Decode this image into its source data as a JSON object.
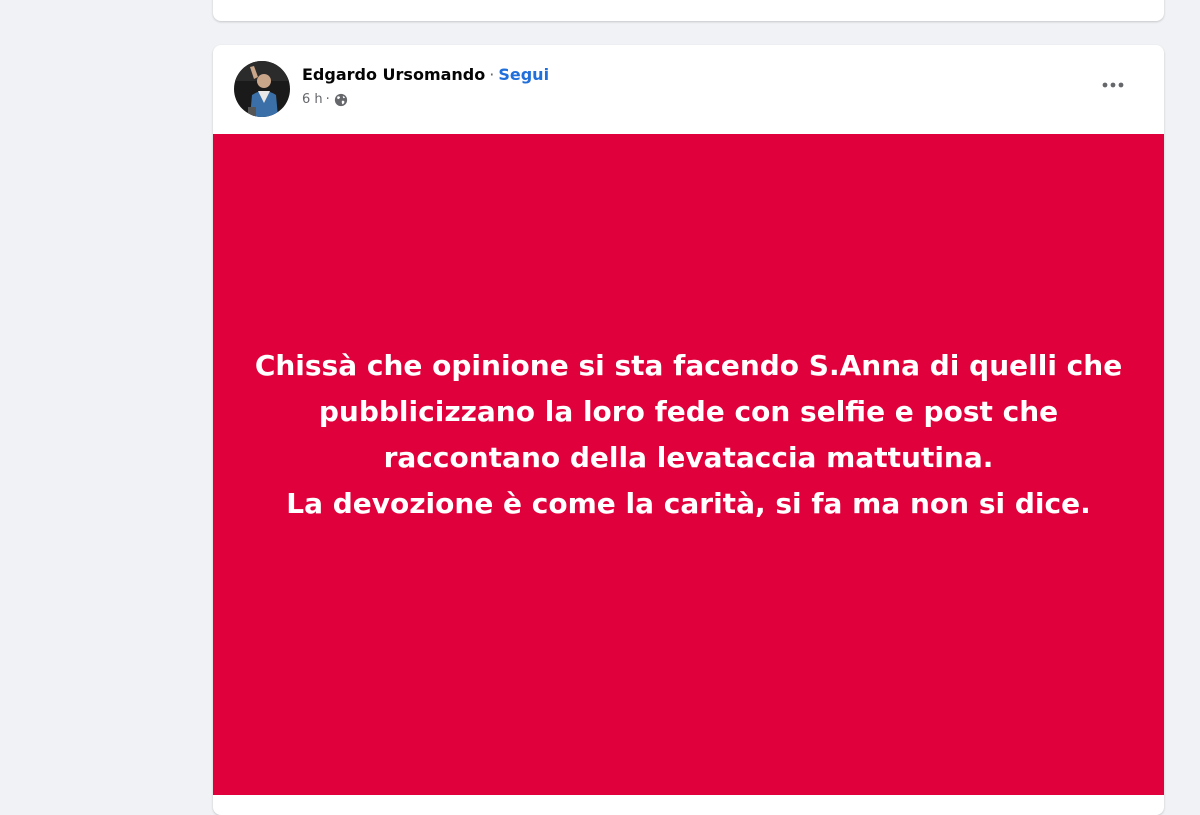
{
  "post": {
    "author": "Edgardo Ursomando",
    "separator": "·",
    "follow_label": "Segui",
    "time": "6 h",
    "meta_separator": "·",
    "privacy_icon": "globe-icon",
    "more_icon": "more-options-icon",
    "background_color": "#e0003b",
    "text_lines": [
      "Chissà che opinione si sta facendo S.Anna di quelli che",
      "pubblicizzano la loro fede con selfie e post che",
      "raccontano della levataccia mattutina.",
      "La devozione è come la carità, si fa ma non si dice."
    ]
  },
  "colors": {
    "page_background": "#f0f2f5",
    "link": "#216fdb",
    "secondary_text": "#65676b"
  }
}
